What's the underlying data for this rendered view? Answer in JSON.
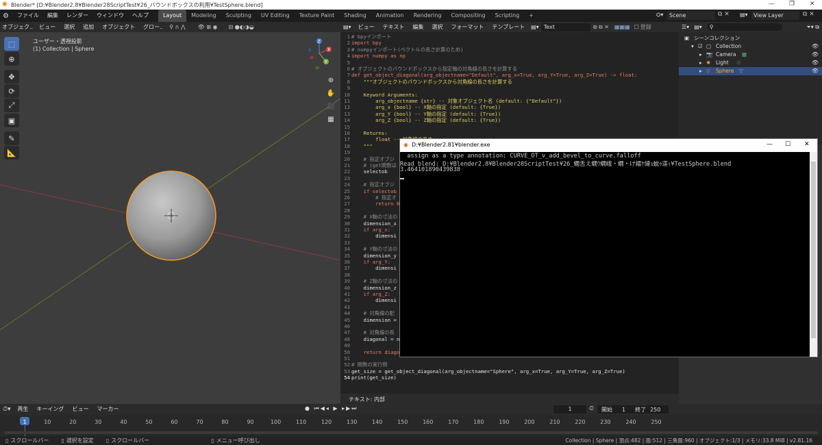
{
  "title_bar": {
    "title": "Blender* [D:¥Blender2.8¥Blender28ScriptTest¥26_バウンドボックスの利用¥TestSphere.blend]"
  },
  "top_menu": [
    "ファイル",
    "編集",
    "レンダー",
    "ウィンドウ",
    "ヘルプ"
  ],
  "workspaces": [
    "Layout",
    "Modeling",
    "Sculpting",
    "UV Editing",
    "Texture Paint",
    "Shading",
    "Animation",
    "Rendering",
    "Compositing",
    "Scripting"
  ],
  "active_workspace": "Layout",
  "scene": "Scene",
  "view_layer": "View Layer",
  "viewport": {
    "header": [
      "オブジェク..",
      "ビュー",
      "選択",
      "追加",
      "オブジェクト",
      "グロー.."
    ],
    "label1": "ユーザー・透視投影",
    "label2": "(1) Collection | Sphere"
  },
  "text_editor": {
    "header": [
      "ビュー",
      "テキスト",
      "編集",
      "選択",
      "フォーマット",
      "テンプレート"
    ],
    "text_name": "Text",
    "register": "登録",
    "footer": "テキスト: 内部",
    "lines": [
      {
        "n": "1",
        "t": "# bpyインポート"
      },
      {
        "n": "2",
        "t": "import bpy"
      },
      {
        "n": "3",
        "t": "# numpyインポート(ベクトルの長さ計算のため)"
      },
      {
        "n": "4",
        "t": "import numpy as np"
      },
      {
        "n": "5",
        "t": ""
      },
      {
        "n": "6",
        "t": "# オブジェクトのバウンドボックスから指定軸の対角線の長さを計算する"
      },
      {
        "n": "7",
        "t": "def get_object_diagonal(arg_objectname=\"Default\", arg_x=True, arg_Y=True, arg_Z=True) -> float:"
      },
      {
        "n": "8",
        "t": "    \"\"\"オブジェクトのバウンドボックスから対角線の長さを計算する"
      },
      {
        "n": "9",
        "t": ""
      },
      {
        "n": "10",
        "t": "    Keyword Arguments:"
      },
      {
        "n": "11",
        "t": "        arg_objectname {str} -- 対象オブジェクト名 (default: {\"Default\"})"
      },
      {
        "n": "12",
        "t": "        arg_x {bool} -- X軸の指定 (default: {True})"
      },
      {
        "n": "13",
        "t": "        arg_Y {bool} -- Y軸の指定 (default: {True})"
      },
      {
        "n": "14",
        "t": "        arg_Z {bool} -- Z軸の指定 (default: {True})"
      },
      {
        "n": "15",
        "t": ""
      },
      {
        "n": "16",
        "t": "    Returns:"
      },
      {
        "n": "17",
        "t": "        float -- 対角線の長さ"
      },
      {
        "n": "18",
        "t": "    \"\"\""
      },
      {
        "n": "19",
        "t": ""
      },
      {
        "n": "20",
        "t": "    # 指定オブジ"
      },
      {
        "n": "21",
        "t": "    # (get関数は"
      },
      {
        "n": "22",
        "t": "    selectob"
      },
      {
        "n": "23",
        "t": ""
      },
      {
        "n": "24",
        "t": "    # 指定オブジ"
      },
      {
        "n": "25",
        "t": "    if selectob"
      },
      {
        "n": "26",
        "t": "        # 指定オ"
      },
      {
        "n": "27",
        "t": "        return 0"
      },
      {
        "n": "28",
        "t": ""
      },
      {
        "n": "29",
        "t": "    # X軸の寸法の"
      },
      {
        "n": "30",
        "t": "    dimension_x"
      },
      {
        "n": "31",
        "t": "    if arg_x:"
      },
      {
        "n": "32",
        "t": "        dimensi"
      },
      {
        "n": "33",
        "t": ""
      },
      {
        "n": "34",
        "t": "    # Y軸の寸法の"
      },
      {
        "n": "35",
        "t": "    dimension_y"
      },
      {
        "n": "36",
        "t": "    if arg_Y:"
      },
      {
        "n": "37",
        "t": "        dimensi"
      },
      {
        "n": "38",
        "t": ""
      },
      {
        "n": "39",
        "t": "    # Z軸の寸法の"
      },
      {
        "n": "40",
        "t": "    dimension_z"
      },
      {
        "n": "41",
        "t": "    if arg_Z:"
      },
      {
        "n": "42",
        "t": "        dimensi"
      },
      {
        "n": "43",
        "t": ""
      },
      {
        "n": "44",
        "t": "    # 対角線の配"
      },
      {
        "n": "45",
        "t": "    dimension ="
      },
      {
        "n": "46",
        "t": ""
      },
      {
        "n": "47",
        "t": "    # 対角線の長"
      },
      {
        "n": "48",
        "t": "    diagonal = n"
      },
      {
        "n": "49",
        "t": ""
      },
      {
        "n": "50",
        "t": "    return diago"
      },
      {
        "n": "51",
        "t": ""
      },
      {
        "n": "52",
        "t": "# 関数の実行例"
      },
      {
        "n": "53",
        "t": "get_size = get_object_diagonal(arg_objectname=\"Sphere\", arg_x=True, arg_Y=True, arg_Z=True)"
      },
      {
        "n": "54",
        "t": "print(get_size)"
      }
    ]
  },
  "outliner": {
    "title": "シーンコレクション",
    "items": [
      "Collection",
      "Camera",
      "Light",
      "Sphere"
    ]
  },
  "console": {
    "title": "D:¥Blender2.81¥blender.exe",
    "lines": [
      "  assign as a type annotation: CURVE_OT_v_add_bevel_to_curve.falloff",
      "Read blend: D:¥Blender2.8¥Blender28ScriptTest¥26_繝舌え繝ｳ繝峨・繝・け繧ｹ縺ｮ蛻ｩ逕ｨ¥TestSphere.blend",
      "3.464101890439838"
    ]
  },
  "timeline": {
    "menu": [
      "再生",
      "キーイング",
      "ビュー",
      "マーカー"
    ],
    "current": "1",
    "start_label": "開始",
    "start": "1",
    "end_label": "終了",
    "end": "250",
    "ticks": [
      "1",
      "10",
      "20",
      "30",
      "40",
      "50",
      "60",
      "70",
      "80",
      "90",
      "100",
      "110",
      "120",
      "130",
      "140",
      "150",
      "160",
      "170",
      "180",
      "190",
      "200",
      "210",
      "220",
      "230",
      "240",
      "250"
    ]
  },
  "status": {
    "left": [
      "スクロールバー",
      "選択を設定",
      "スクロールバー",
      "メニュー呼び出し"
    ],
    "right": "Collection | Sphere | 頂点:482 | 面:512 | 三角面:960 | オブジェクト:1/3 | メモリ:33.8 MiB | v2.81.16"
  }
}
